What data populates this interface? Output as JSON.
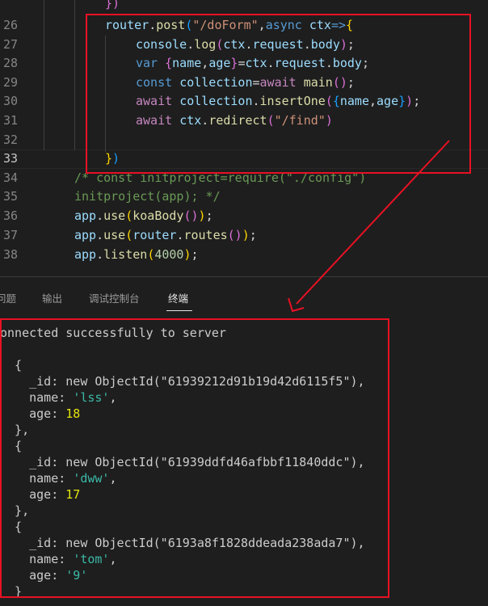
{
  "editor": {
    "lines": [
      {
        "number": "",
        "tokens": [
          [
            "})",
            "bracket2"
          ]
        ]
      },
      {
        "number": "26",
        "tokens": [
          [
            "router",
            "var"
          ],
          [
            ".",
            "punc"
          ],
          [
            "post",
            "fn"
          ],
          [
            "(",
            "bracket3"
          ],
          [
            "\"/doForm\"",
            "str"
          ],
          [
            ",",
            "punc"
          ],
          [
            "async",
            "kw"
          ],
          [
            " ",
            "punc"
          ],
          [
            "ctx",
            "var"
          ],
          [
            "=>",
            "kw"
          ],
          [
            "{",
            "bracket1"
          ]
        ]
      },
      {
        "number": "27",
        "tokens": [
          [
            "console",
            "var"
          ],
          [
            ".",
            "punc"
          ],
          [
            "log",
            "fn"
          ],
          [
            "(",
            "bracket2"
          ],
          [
            "ctx",
            "var"
          ],
          [
            ".",
            "punc"
          ],
          [
            "request",
            "var"
          ],
          [
            ".",
            "punc"
          ],
          [
            "body",
            "var"
          ],
          [
            ")",
            "bracket2"
          ],
          [
            ";",
            "punc"
          ]
        ]
      },
      {
        "number": "28",
        "tokens": [
          [
            "var",
            "kw"
          ],
          [
            " ",
            "punc"
          ],
          [
            "{",
            "bracket2"
          ],
          [
            "name",
            "var"
          ],
          [
            ",",
            "punc"
          ],
          [
            "age",
            "var"
          ],
          [
            "}",
            "bracket2"
          ],
          [
            "=",
            "punc"
          ],
          [
            "ctx",
            "var"
          ],
          [
            ".",
            "punc"
          ],
          [
            "request",
            "var"
          ],
          [
            ".",
            "punc"
          ],
          [
            "body",
            "var"
          ],
          [
            ";",
            "punc"
          ]
        ]
      },
      {
        "number": "29",
        "tokens": [
          [
            "const",
            "kw"
          ],
          [
            " ",
            "punc"
          ],
          [
            "collection",
            "var"
          ],
          [
            "=",
            "punc"
          ],
          [
            "await",
            "flow"
          ],
          [
            " ",
            "punc"
          ],
          [
            "main",
            "fn"
          ],
          [
            "()",
            "bracket2"
          ],
          [
            ";",
            "punc"
          ]
        ]
      },
      {
        "number": "30",
        "tokens": [
          [
            "await",
            "flow"
          ],
          [
            " ",
            "punc"
          ],
          [
            "collection",
            "var"
          ],
          [
            ".",
            "punc"
          ],
          [
            "insertOne",
            "fn"
          ],
          [
            "(",
            "bracket2"
          ],
          [
            "{",
            "bracket3"
          ],
          [
            "name",
            "var"
          ],
          [
            ",",
            "punc"
          ],
          [
            "age",
            "var"
          ],
          [
            "}",
            "bracket3"
          ],
          [
            ")",
            "bracket2"
          ],
          [
            ";",
            "punc"
          ]
        ]
      },
      {
        "number": "31",
        "tokens": [
          [
            "await",
            "flow"
          ],
          [
            " ",
            "punc"
          ],
          [
            "ctx",
            "var"
          ],
          [
            ".",
            "punc"
          ],
          [
            "redirect",
            "fn"
          ],
          [
            "(",
            "bracket2"
          ],
          [
            "\"/find\"",
            "str"
          ],
          [
            ")",
            "bracket2"
          ]
        ]
      },
      {
        "number": "32",
        "tokens": []
      },
      {
        "number": "33",
        "tokens": [
          [
            "}",
            "bracket1"
          ],
          [
            ")",
            "bracket3"
          ]
        ]
      },
      {
        "number": "34",
        "tokens": [
          [
            "/* const initproject=require(\"./config\")",
            "comment"
          ]
        ]
      },
      {
        "number": "35",
        "tokens": [
          [
            "initproject(app); */",
            "comment"
          ]
        ]
      },
      {
        "number": "36",
        "tokens": [
          [
            "app",
            "var"
          ],
          [
            ".",
            "punc"
          ],
          [
            "use",
            "fn"
          ],
          [
            "(",
            "bracket1"
          ],
          [
            "koaBody",
            "fn"
          ],
          [
            "()",
            "bracket2"
          ],
          [
            ")",
            "bracket1"
          ],
          [
            ";",
            "punc"
          ]
        ]
      },
      {
        "number": "37",
        "tokens": [
          [
            "app",
            "var"
          ],
          [
            ".",
            "punc"
          ],
          [
            "use",
            "fn"
          ],
          [
            "(",
            "bracket1"
          ],
          [
            "router",
            "var"
          ],
          [
            ".",
            "punc"
          ],
          [
            "routes",
            "fn"
          ],
          [
            "()",
            "bracket2"
          ],
          [
            ")",
            "bracket1"
          ],
          [
            ";",
            "punc"
          ]
        ]
      },
      {
        "number": "38",
        "tokens": [
          [
            "app",
            "var"
          ],
          [
            ".",
            "punc"
          ],
          [
            "listen",
            "fn"
          ],
          [
            "(",
            "bracket1"
          ],
          [
            "4000",
            "num"
          ],
          [
            ")",
            "bracket1"
          ],
          [
            ";",
            "punc"
          ]
        ]
      }
    ]
  },
  "panel": {
    "tabs": [
      {
        "label": "问题",
        "active": false
      },
      {
        "label": "输出",
        "active": false
      },
      {
        "label": "调试控制台",
        "active": false
      },
      {
        "label": "终端",
        "active": true
      }
    ]
  },
  "terminal": {
    "lines": [
      [
        [
          "onnected successfully to server",
          "plain"
        ]
      ],
      [
        [
          "",
          "plain"
        ]
      ],
      [
        [
          "  {",
          "plain"
        ]
      ],
      [
        [
          "    _id: new ObjectId(\"61939212d91b19d42d6115f5\"),",
          "plain"
        ]
      ],
      [
        [
          "    name: ",
          "plain"
        ],
        [
          "'lss'",
          "str"
        ],
        [
          ",",
          "plain"
        ]
      ],
      [
        [
          "    age: ",
          "plain"
        ],
        [
          "18",
          "num"
        ]
      ],
      [
        [
          "  },",
          "plain"
        ]
      ],
      [
        [
          "  {",
          "plain"
        ]
      ],
      [
        [
          "    _id: new ObjectId(\"61939ddfd46afbbf11840ddc\"),",
          "plain"
        ]
      ],
      [
        [
          "    name: ",
          "plain"
        ],
        [
          "'dww'",
          "str"
        ],
        [
          ",",
          "plain"
        ]
      ],
      [
        [
          "    age: ",
          "plain"
        ],
        [
          "17",
          "num"
        ]
      ],
      [
        [
          "  },",
          "plain"
        ]
      ],
      [
        [
          "  {",
          "plain"
        ]
      ],
      [
        [
          "    _id: new ObjectId(\"6193a8f1828ddeada238ada7\"),",
          "plain"
        ]
      ],
      [
        [
          "    name: ",
          "plain"
        ],
        [
          "'tom'",
          "str"
        ],
        [
          ",",
          "plain"
        ]
      ],
      [
        [
          "    age: ",
          "plain"
        ],
        [
          "'9'",
          "str"
        ]
      ],
      [
        [
          "  }",
          "plain"
        ]
      ]
    ]
  },
  "annotation": {
    "box_color": "#e81123"
  }
}
